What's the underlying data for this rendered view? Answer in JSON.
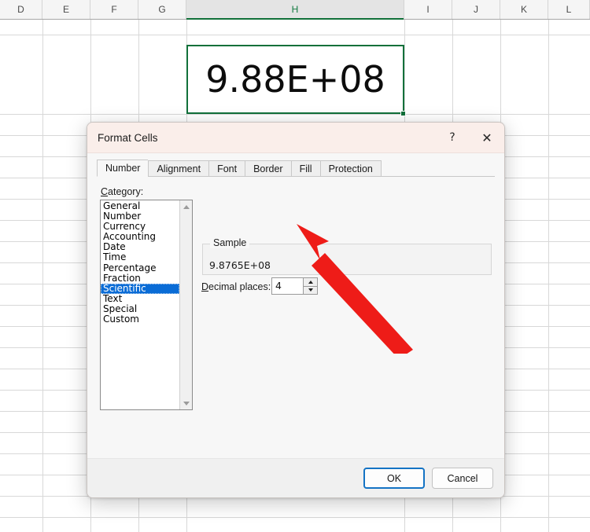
{
  "spreadsheet": {
    "column_headers": [
      "D",
      "E",
      "F",
      "G",
      "H",
      "I",
      "J",
      "K",
      "L"
    ],
    "selected_column": "H",
    "selected_cell_value": "9.88E+08"
  },
  "dialog": {
    "title": "Format Cells",
    "help_icon": "?",
    "close_icon": "✕",
    "tabs": [
      {
        "label": "Number",
        "active": true
      },
      {
        "label": "Alignment",
        "active": false
      },
      {
        "label": "Font",
        "active": false
      },
      {
        "label": "Border",
        "active": false
      },
      {
        "label": "Fill",
        "active": false
      },
      {
        "label": "Protection",
        "active": false
      }
    ],
    "category": {
      "label": "Category:",
      "items": [
        "General",
        "Number",
        "Currency",
        "Accounting",
        "Date",
        "Time",
        "Percentage",
        "Fraction",
        "Scientific",
        "Text",
        "Special",
        "Custom"
      ],
      "selected": "Scientific"
    },
    "sample": {
      "legend": "Sample",
      "value": "9.8765E+08"
    },
    "decimal_places": {
      "label": "Decimal places:",
      "value": "4"
    },
    "buttons": {
      "ok": "OK",
      "cancel": "Cancel"
    }
  },
  "annotation": {
    "color": "#ee1c18",
    "points_to": "decimal-places-spinner"
  }
}
